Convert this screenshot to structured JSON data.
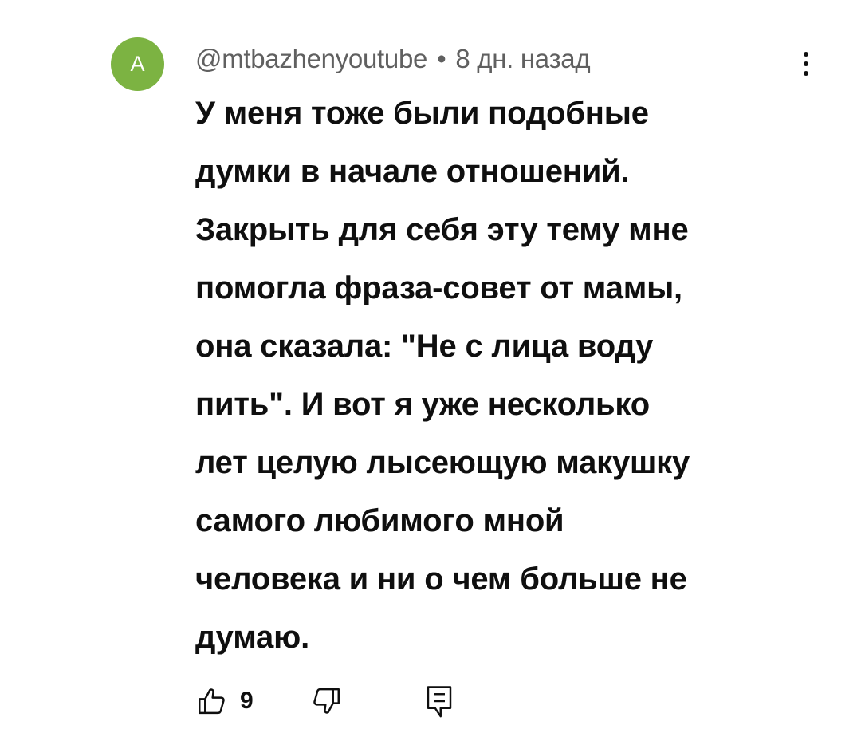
{
  "comment": {
    "avatar_letter": "A",
    "avatar_color": "#7cb342",
    "author": "@mtbazhenyoutube",
    "separator": "•",
    "time": "8 дн. назад",
    "body_lines": [
      "У меня тоже были подобные",
      "думки в начале отношений.",
      "Закрыть для себя эту тему мне",
      "помогла фраза-совет от мамы,",
      "она сказала: \"Не с лица воду",
      "пить\". И вот я уже несколько",
      "лет целую лысеющую макушку",
      "самого любимого мной",
      "человека и ни о чем больше не",
      "думаю."
    ],
    "like_count": "9",
    "icons": {
      "more": "more-vertical-icon",
      "like": "thumbs-up-icon",
      "dislike": "thumbs-down-icon",
      "reply": "reply-icon"
    }
  }
}
